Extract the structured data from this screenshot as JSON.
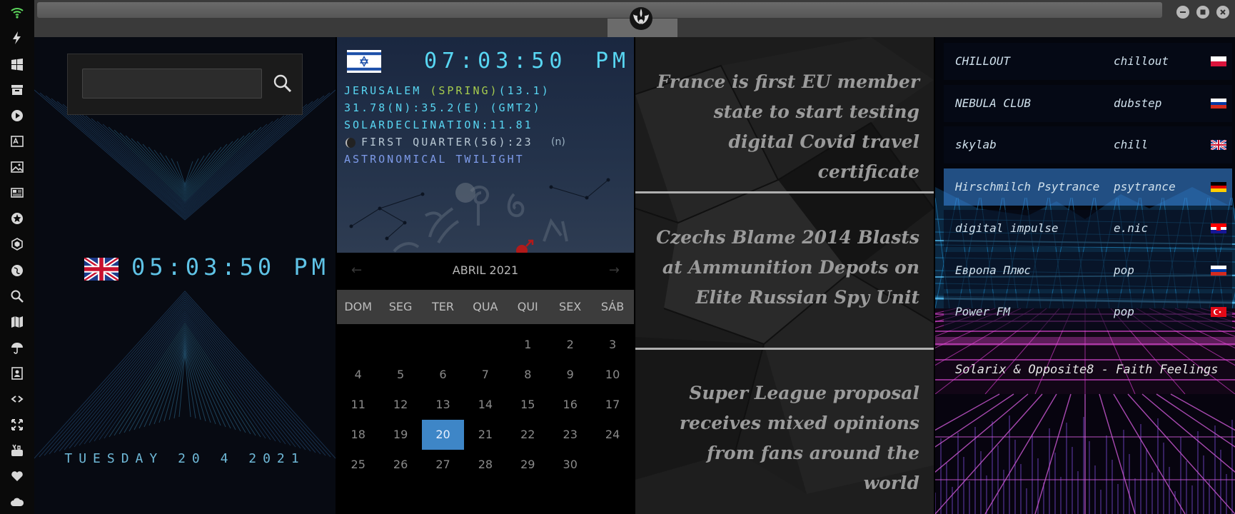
{
  "rail": {
    "icons": [
      "wifi-icon",
      "lightning-icon",
      "windows-icon",
      "archive-icon",
      "play-icon",
      "translate-icon",
      "image-icon",
      "news-icon",
      "rebel-icon",
      "hexagon-icon",
      "globe-icon",
      "search-icon",
      "map-icon",
      "umbrella-icon",
      "contact-icon",
      "link-icon",
      "fullscreen-icon",
      "youtube-icon",
      "heart-icon",
      "cloud-icon"
    ]
  },
  "clock_panel": {
    "search_placeholder": "",
    "local_time": "05:03:50 PM",
    "date": "TUESDAY 20 4 2021"
  },
  "city_panel": {
    "time": "07:03:50",
    "ampm": "PM",
    "city": "JERUSALEM",
    "season": "(SPRING)",
    "season_value": "(13.1)",
    "coords": "31.78(N):35.2(E) (GMT2)",
    "declination": "SOLARDECLINATION:11.81",
    "moon_phase": "FIRST QUARTER(56):23",
    "moon_suffix": "(n)",
    "twilight": "ASTRONOMICAL TWILIGHT"
  },
  "calendar": {
    "prev": "←",
    "next": "→",
    "title": "ABRIL 2021",
    "weekdays": [
      "DOM",
      "SEG",
      "TER",
      "QUA",
      "QUI",
      "SEX",
      "SÁB"
    ],
    "days": [
      "1",
      "2",
      "3",
      "4",
      "5",
      "6",
      "7",
      "8",
      "9",
      "10",
      "11",
      "12",
      "13",
      "14",
      "15",
      "16",
      "17",
      "18",
      "19",
      "20",
      "21",
      "22",
      "23",
      "24",
      "25",
      "26",
      "27",
      "28",
      "29",
      "30"
    ],
    "first_weekday_index": 4,
    "selected": "20"
  },
  "news": {
    "items": [
      "France is first EU member state to start testing digital Covid travel certificate",
      "Czechs Blame 2014 Blasts at Ammunition Depots on Elite Russian Spy Unit",
      "Super League proposal receives mixed opinions from fans around the world"
    ]
  },
  "radio": {
    "stations": [
      {
        "name": "CHILLOUT",
        "genre": "chillout",
        "flag": "pl"
      },
      {
        "name": "NEBULA CLUB",
        "genre": "dubstep",
        "flag": "ru"
      },
      {
        "name": "skylab",
        "genre": "chill",
        "flag": "gb"
      },
      {
        "name": "Hirschmilch Psytrance",
        "genre": "psytrance",
        "flag": "de"
      },
      {
        "name": "digital impulse",
        "genre": "e.nic",
        "flag": "hr"
      },
      {
        "name": "Европа Плюс",
        "genre": "pop",
        "flag": "ru"
      },
      {
        "name": "Power FM",
        "genre": "pop",
        "flag": "tr"
      }
    ],
    "active_index": 3,
    "now_playing": "Solarix & Opposite8 - Faith Feelings"
  }
}
